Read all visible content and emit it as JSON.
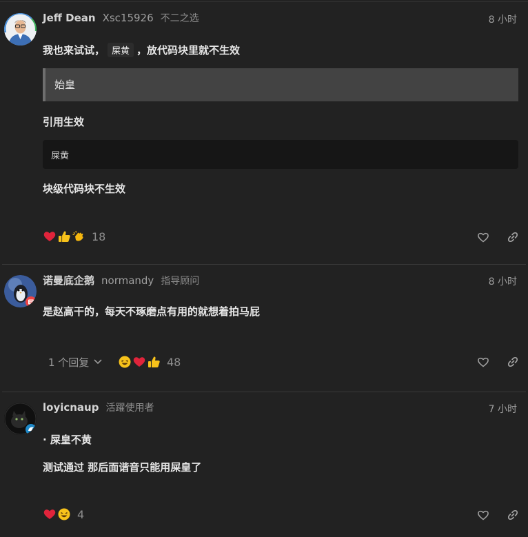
{
  "posts": [
    {
      "username": "Jeff Dean",
      "fullname": "Xsc15926",
      "user_title": "不二之选",
      "time": "8 小时",
      "line1_before": "我也来试试，",
      "line1_code": "屎黄",
      "line1_after": "，放代码块里就不生效",
      "quote": "始皇",
      "line2": "引用生效",
      "codeblock": "屎黄",
      "line3": "块级代码块不生效",
      "reactions": [
        "heart-emoji",
        "thumbs-up-emoji",
        "clap-emoji"
      ],
      "reaction_count": "18"
    },
    {
      "username": "诺曼底企鹅",
      "fullname": "normandy",
      "user_title": "指导顾问",
      "time": "8 小时",
      "line1": "是赵高干的，每天不琢磨点有用的就想着拍马屁",
      "replies_label": "1 个回复",
      "reactions": [
        "laughing-emoji",
        "heart-emoji",
        "thumbs-up-emoji"
      ],
      "reaction_count": "48"
    },
    {
      "username": "loyicnaup",
      "user_title": "活躍使用者",
      "time": "7 小时",
      "line1": "· 屎皇不黄",
      "line2": "测试通过 那后面谐音只能用屎皇了",
      "reactions": [
        "heart-emoji",
        "laughing-emoji"
      ],
      "reaction_count": "4"
    }
  ],
  "colors": {
    "background": "#222222",
    "heart": "#e0243b",
    "thumb": "#f7c21b",
    "clap": "#f5b70f",
    "quote_bg": "#434343",
    "code_bg": "#161616"
  }
}
